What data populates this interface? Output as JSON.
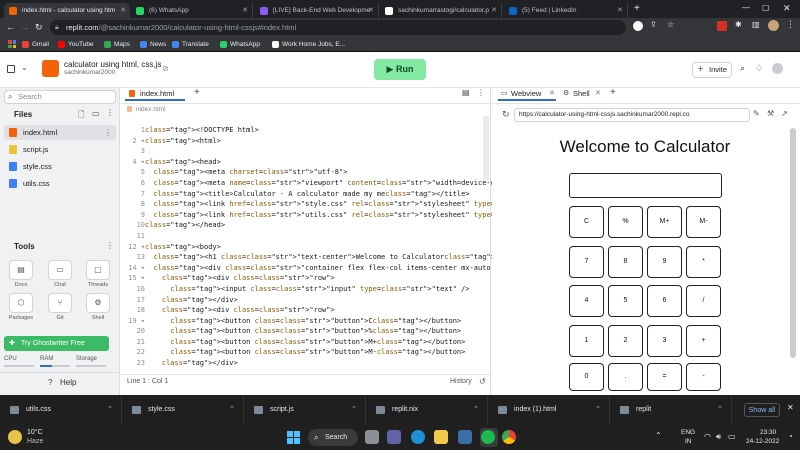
{
  "browser": {
    "tabs": [
      {
        "title": "index.html - calculator using htm",
        "active": true,
        "fav_color": "#f26207"
      },
      {
        "title": "(6) WhatsApp",
        "active": false,
        "fav_color": "#25d366"
      },
      {
        "title": "[LIVE] Back-End Web Developme",
        "active": false,
        "fav_color": "#8b5cf6"
      },
      {
        "title": "sachinkumarrastogi/calculator.p",
        "active": false,
        "fav_color": "#ffffff"
      },
      {
        "title": "(5) Feed | LinkedIn",
        "active": false,
        "fav_color": "#0a66c2"
      }
    ],
    "url_host": "replit.com",
    "url_path": "/@sachinkumar2000/calculator-using-html-cssjs#index.html",
    "bookmarks": [
      {
        "label": "Gmail",
        "color": "#ea4335"
      },
      {
        "label": "YouTube",
        "color": "#ff0000"
      },
      {
        "label": "Maps",
        "color": "#34a853"
      },
      {
        "label": "News",
        "color": "#4285f4"
      },
      {
        "label": "Translate",
        "color": "#4285f4"
      },
      {
        "label": "WhatsApp",
        "color": "#25d366"
      },
      {
        "label": "Work Home Jobs, E...",
        "color": "#ffffff"
      }
    ]
  },
  "replit": {
    "project_title": "calculator using html, css,js",
    "owner": "sachinkumar2000",
    "run_label": "Run",
    "invite_label": "Invite",
    "search_placeholder": "Search",
    "files_heading": "Files",
    "files": [
      {
        "name": "index.html",
        "type": "html",
        "selected": true
      },
      {
        "name": "script.js",
        "type": "js",
        "selected": false
      },
      {
        "name": "style.css",
        "type": "css",
        "selected": false
      },
      {
        "name": "utils.css",
        "type": "css",
        "selected": false
      }
    ],
    "tools_heading": "Tools",
    "tools": [
      {
        "label": "Docs",
        "icon": "docs-icon",
        "glyph": "▤"
      },
      {
        "label": "Chat",
        "icon": "chat-icon",
        "glyph": "▭"
      },
      {
        "label": "Threads",
        "icon": "threads-icon",
        "glyph": "▢"
      },
      {
        "label": "Packages",
        "icon": "packages-icon",
        "glyph": "⬡"
      },
      {
        "label": "Git",
        "icon": "git-icon",
        "glyph": "⑂"
      },
      {
        "label": "Shell",
        "icon": "shell-icon",
        "glyph": "⚙"
      }
    ],
    "ghostwriter_label": "Try Ghostwriter Free",
    "meters": {
      "cpu": "CPU",
      "ram": "RAM",
      "storage": "Storage"
    },
    "help_label": "Help",
    "editor_tab": "index.html",
    "breadcrumb": "index.html",
    "status_left": "Line 1 : Col 1",
    "status_right": "History",
    "webview_tab": "Webview",
    "shell_tab": "Shell",
    "webview_url": "https://calculator-using-html-cssjs.sachinkumar2000.repl.co"
  },
  "code_lines": [
    "<!DOCTYPE html>",
    "<html>",
    "",
    "<head>",
    "  <meta charset=\"utf-8\">",
    "  <meta name=\"viewport\" content=\"width=device-width\">",
    "  <title>Calculator - A calculator made my me</title>",
    "  <link href=\"style.css\" rel=\"stylesheet\" type=\"text/css\" />",
    "  <link href=\"utils.css\" rel=\"stylesheet\" type=\"text/css\" />",
    "</head>",
    "",
    "<body>",
    "  <h1 class=\"text-center\">Welcome to Calculator</h1>",
    "  <div class=\"container flex flex-col items-center mx-auto m-w-20\">",
    "    <div class=\"row\">",
    "      <input class=\"input\" type=\"text\" />",
    "    </div>",
    "    <div class=\"row\">",
    "      <button class=\"button\">C</button>",
    "      <button class=\"button\">%</button>",
    "      <button class=\"button\">M+</button>",
    "      <button class=\"button\">M-</button>",
    "    </div>"
  ],
  "fold_lines": [
    2,
    4,
    12,
    14,
    15,
    19
  ],
  "calculator": {
    "title": "Welcome to Calculator",
    "rows": [
      [
        "C",
        "%",
        "M+",
        "M-"
      ],
      [
        "7",
        "8",
        "9",
        "*"
      ],
      [
        "4",
        "5",
        "6",
        "/"
      ],
      [
        "1",
        "2",
        "3",
        "+"
      ],
      [
        "0",
        ".",
        "=",
        "-"
      ]
    ]
  },
  "taskbar_downloads": [
    {
      "name": "utils.css"
    },
    {
      "name": "style.css"
    },
    {
      "name": "script.js"
    },
    {
      "name": "replit.nix"
    },
    {
      "name": "index (1).html"
    },
    {
      "name": "replit"
    }
  ],
  "show_all_label": "Show all",
  "windows": {
    "weather_temp": "10°C",
    "weather_desc": "Haze",
    "search_label": "Search",
    "lang": "ENG",
    "region": "IN",
    "time": "23:30",
    "date": "24-12-2022"
  }
}
